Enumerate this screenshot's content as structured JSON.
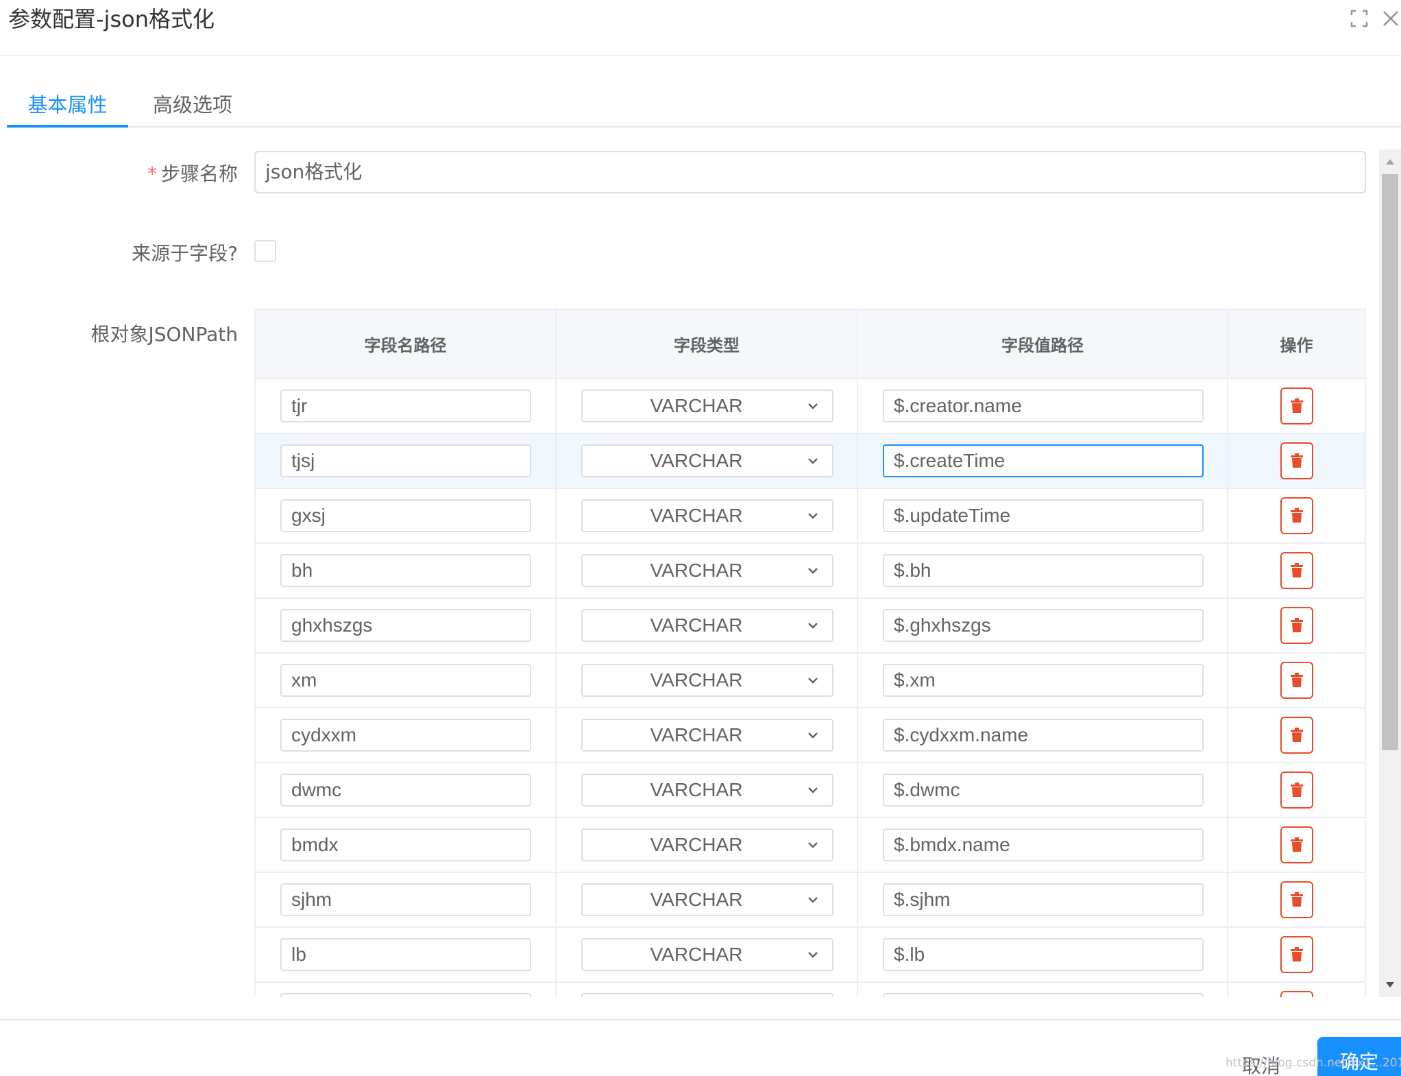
{
  "dialog": {
    "title": "参数配置-json格式化"
  },
  "tabs": [
    {
      "label": "基本属性",
      "active": true
    },
    {
      "label": "高级选项",
      "active": false
    }
  ],
  "form": {
    "required_mark": "*",
    "step_name_label": "步骤名称",
    "step_name_value": "json格式化",
    "from_field_label": "来源于字段?",
    "from_field_checked": false,
    "root_path_label": "根对象JSONPath"
  },
  "table": {
    "headers": [
      "字段名路径",
      "字段类型",
      "字段值路径",
      "操作"
    ],
    "rows": [
      {
        "name": "tjr",
        "type": "VARCHAR",
        "path": "$.creator.name"
      },
      {
        "name": "tjsj",
        "type": "VARCHAR",
        "path": "$.createTime"
      },
      {
        "name": "gxsj",
        "type": "VARCHAR",
        "path": "$.updateTime"
      },
      {
        "name": "bh",
        "type": "VARCHAR",
        "path": "$.bh"
      },
      {
        "name": "ghxhszgs",
        "type": "VARCHAR",
        "path": "$.ghxhszgs"
      },
      {
        "name": "xm",
        "type": "VARCHAR",
        "path": "$.xm"
      },
      {
        "name": "cydxxm",
        "type": "VARCHAR",
        "path": "$.cydxxm.name"
      },
      {
        "name": "dwmc",
        "type": "VARCHAR",
        "path": "$.dwmc"
      },
      {
        "name": "bmdx",
        "type": "VARCHAR",
        "path": "$.bmdx.name"
      },
      {
        "name": "sjhm",
        "type": "VARCHAR",
        "path": "$.sjhm"
      },
      {
        "name": "lb",
        "type": "VARCHAR",
        "path": "$.lb"
      },
      {
        "name": "",
        "type": "",
        "path": ""
      }
    ]
  },
  "footer": {
    "cancel_label": "取消",
    "ok_label": "确定",
    "watermark": "https://blog.csdn.net/xx1...201"
  },
  "colors": {
    "primary": "#1890ff",
    "danger": "#e84c2b",
    "border": "#dcdfe6"
  }
}
